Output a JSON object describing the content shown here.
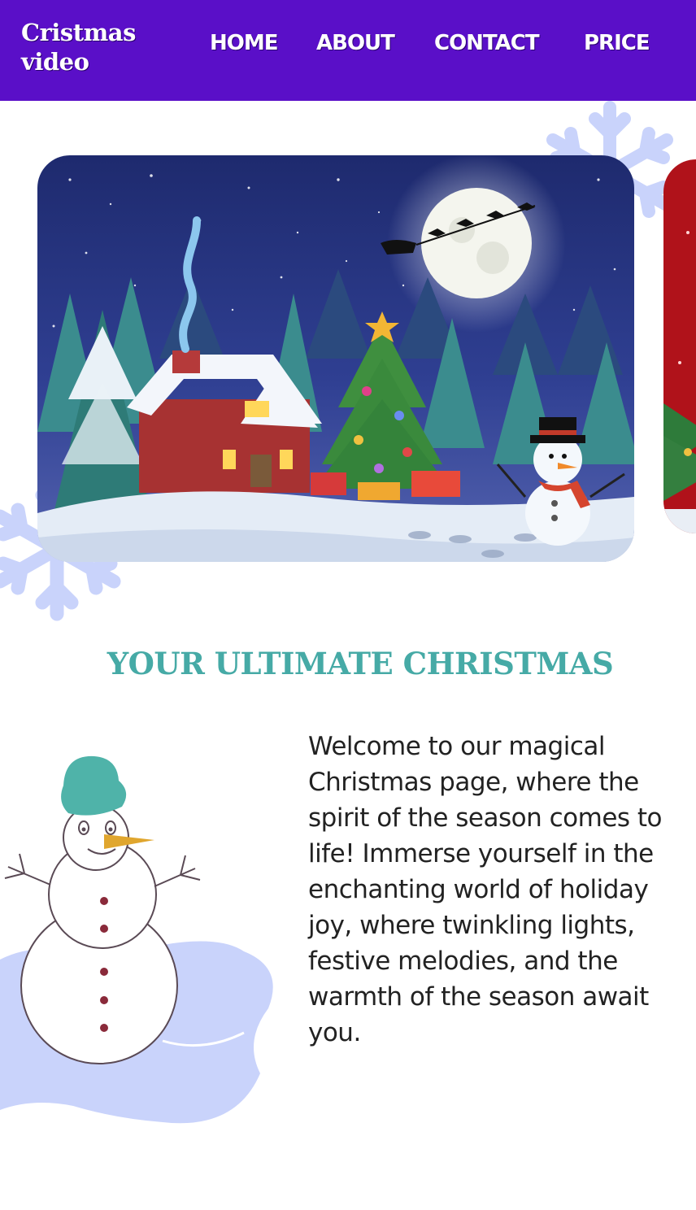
{
  "header": {
    "logo": "Cristmas video",
    "nav": [
      {
        "label": "HOME"
      },
      {
        "label": "ABOUT"
      },
      {
        "label": "CONTACT"
      },
      {
        "label": "PRICE"
      }
    ]
  },
  "intro": {
    "title": "YOUR ULTIMATE CHRISTMAS",
    "text": "Welcome to our magical Christmas page, where the spirit of the season comes to life! Immerse yourself in the enchanting world of holiday joy, where twinkling lights, festive melodies, and the warmth of the season await you."
  },
  "colors": {
    "nav_bg": "#5a0fc8",
    "title": "#46aaa6",
    "snowflake": "#c9d3fb",
    "snowman_hat": "#4fb3a9"
  },
  "icons": [
    "snowflake-icon",
    "snowman-icon"
  ]
}
